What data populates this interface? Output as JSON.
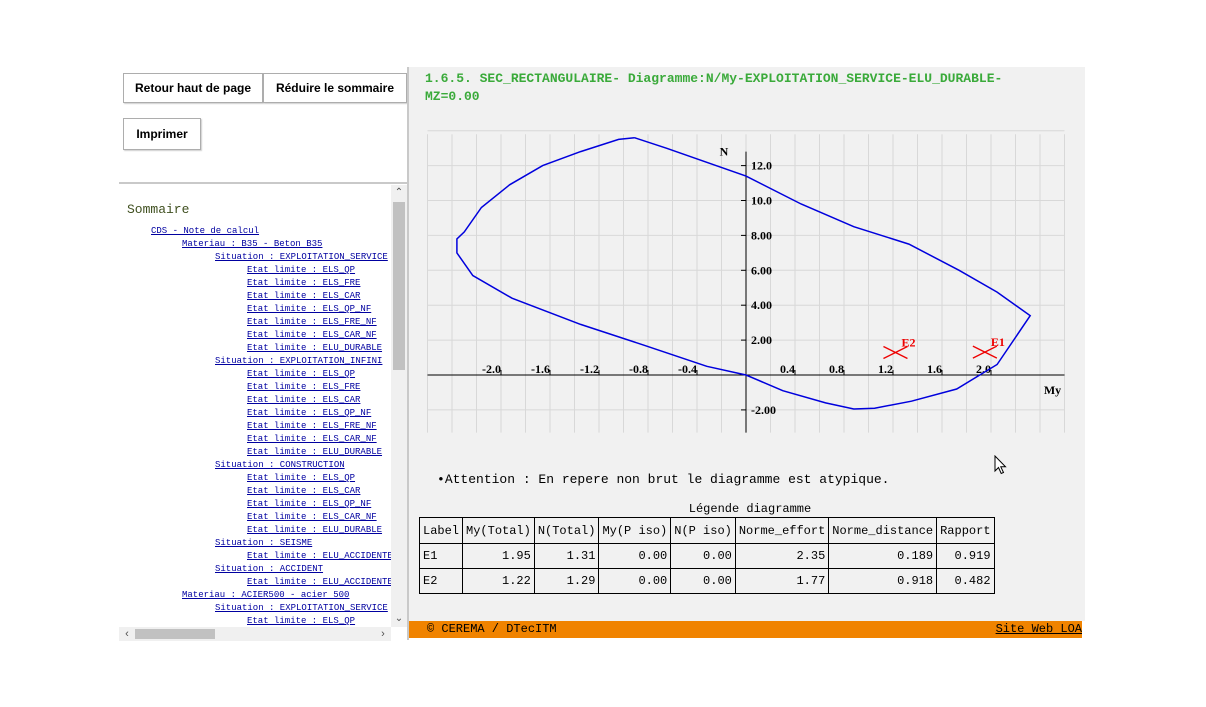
{
  "buttons": {
    "top": "Retour haut de page",
    "reduce": "Réduire le sommaire",
    "print": "Imprimer"
  },
  "toc": {
    "title": "Sommaire",
    "items": [
      {
        "level": 0,
        "label": "CDS - Note de calcul"
      },
      {
        "level": 1,
        "label": "Materiau : B35 - Beton B35"
      },
      {
        "level": 2,
        "label": "Situation : EXPLOITATION_SERVICE"
      },
      {
        "level": 3,
        "label": "Etat limite : ELS_QP"
      },
      {
        "level": 3,
        "label": "Etat limite : ELS_FRE"
      },
      {
        "level": 3,
        "label": "Etat limite : ELS_CAR"
      },
      {
        "level": 3,
        "label": "Etat limite : ELS_QP_NF"
      },
      {
        "level": 3,
        "label": "Etat limite : ELS_FRE_NF"
      },
      {
        "level": 3,
        "label": "Etat limite : ELS_CAR_NF"
      },
      {
        "level": 3,
        "label": "Etat limite : ELU_DURABLE"
      },
      {
        "level": 2,
        "label": "Situation : EXPLOITATION_INFINI"
      },
      {
        "level": 3,
        "label": "Etat limite : ELS_QP"
      },
      {
        "level": 3,
        "label": "Etat limite : ELS_FRE"
      },
      {
        "level": 3,
        "label": "Etat limite : ELS_CAR"
      },
      {
        "level": 3,
        "label": "Etat limite : ELS_QP_NF"
      },
      {
        "level": 3,
        "label": "Etat limite : ELS_FRE_NF"
      },
      {
        "level": 3,
        "label": "Etat limite : ELS_CAR_NF"
      },
      {
        "level": 3,
        "label": "Etat limite : ELU_DURABLE"
      },
      {
        "level": 2,
        "label": "Situation : CONSTRUCTION"
      },
      {
        "level": 3,
        "label": "Etat limite : ELS_QP"
      },
      {
        "level": 3,
        "label": "Etat limite : ELS_CAR"
      },
      {
        "level": 3,
        "label": "Etat limite : ELS_QP_NF"
      },
      {
        "level": 3,
        "label": "Etat limite : ELS_CAR_NF"
      },
      {
        "level": 3,
        "label": "Etat limite : ELU_DURABLE"
      },
      {
        "level": 2,
        "label": "Situation : SEISME"
      },
      {
        "level": 3,
        "label": "Etat limite : ELU_ACCIDENTEL"
      },
      {
        "level": 2,
        "label": "Situation : ACCIDENT"
      },
      {
        "level": 3,
        "label": "Etat limite : ELU_ACCIDENTEL"
      },
      {
        "level": 1,
        "label": "Materiau : ACIER500 - acier 500"
      },
      {
        "level": 2,
        "label": "Situation : EXPLOITATION_SERVICE"
      },
      {
        "level": 3,
        "label": "Etat limite : ELS_QP"
      }
    ]
  },
  "main": {
    "heading": "1.6.5. SEC_RECTANGULAIRE- Diagramme:N/My-EXPLOITATION_SERVICE-ELU_DURABLE-MZ=0.00",
    "warning": "Attention : En repere non brut le diagramme est atypique.",
    "legend_caption": "Légende diagramme",
    "table": {
      "headers": [
        "Label",
        "My(Total)",
        "N(Total)",
        "My(P iso)",
        "N(P iso)",
        "Norme_effort",
        "Norme_distance",
        "Rapport"
      ],
      "rows": [
        [
          "E1",
          "1.95",
          "1.31",
          "0.00",
          "0.00",
          "2.35",
          "0.189",
          "0.919"
        ],
        [
          "E2",
          "1.22",
          "1.29",
          "0.00",
          "0.00",
          "1.77",
          "0.918",
          "0.482"
        ]
      ]
    }
  },
  "footer": {
    "copyright": "© CEREMA / DTecITM",
    "site_link": "Site Web LOA"
  },
  "chart_data": {
    "type": "line",
    "xlabel": "My",
    "ylabel": "N",
    "xlim": [
      -2.6,
      2.6
    ],
    "ylim": [
      -3.3,
      13.8
    ],
    "x_ticks": [
      "-2.0",
      "-1.6",
      "-1.2",
      "-0.8",
      "-0.4",
      "0.4",
      "0.8",
      "1.2",
      "1.6",
      "2.0"
    ],
    "y_ticks": [
      "12.0",
      "10.0",
      "8.00",
      "6.00",
      "4.00",
      "2.00",
      "-2.00"
    ],
    "grid": true,
    "series": [
      {
        "color": "#0000dd",
        "points": [
          [
            -0.91,
            13.6
          ],
          [
            -1.04,
            13.5
          ],
          [
            -1.35,
            12.8
          ],
          [
            -1.66,
            12.0
          ],
          [
            -1.93,
            10.9
          ],
          [
            -2.16,
            9.6
          ],
          [
            -2.3,
            8.2
          ],
          [
            -2.36,
            7.8
          ],
          [
            -2.36,
            7.0
          ],
          [
            -2.23,
            5.7
          ],
          [
            -1.91,
            4.4
          ],
          [
            -1.35,
            2.9
          ],
          [
            -0.83,
            1.7
          ],
          [
            -0.32,
            0.5
          ],
          [
            0.0,
            0.0
          ],
          [
            0.3,
            -0.9
          ],
          [
            0.65,
            -1.6
          ],
          [
            0.88,
            -1.95
          ],
          [
            1.05,
            -1.9
          ],
          [
            1.35,
            -1.5
          ],
          [
            1.72,
            -0.8
          ],
          [
            2.05,
            0.6
          ],
          [
            2.32,
            3.4
          ],
          [
            2.05,
            4.75
          ],
          [
            1.74,
            6.0
          ],
          [
            1.33,
            7.5
          ],
          [
            0.88,
            8.5
          ],
          [
            0.45,
            9.8
          ],
          [
            0.0,
            11.4
          ],
          [
            -0.65,
            13.0
          ],
          [
            -0.91,
            13.6
          ]
        ]
      }
    ],
    "points": [
      {
        "label": "E1",
        "my": 1.95,
        "n": 1.31,
        "color": "#ee0000"
      },
      {
        "label": "E2",
        "my": 1.22,
        "n": 1.29,
        "color": "#ee0000"
      }
    ]
  }
}
